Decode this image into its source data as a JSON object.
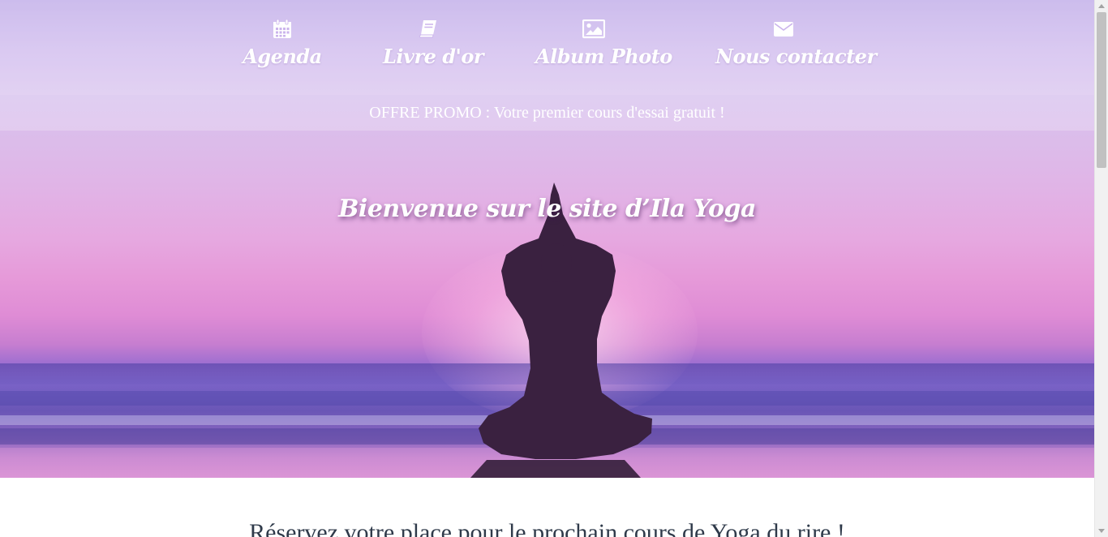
{
  "nav": {
    "items": [
      {
        "label": "Agenda",
        "icon": "calendar-icon"
      },
      {
        "label": "Livre d'or",
        "icon": "book-icon"
      },
      {
        "label": "Album Photo",
        "icon": "image-icon"
      },
      {
        "label": "Nous contacter",
        "icon": "envelope-icon"
      }
    ]
  },
  "promo": {
    "text": "OFFRE PROMO : Votre premier cours d'essai gratuit !"
  },
  "hero": {
    "title": "Bienvenue sur le site d’Ila Yoga"
  },
  "section": {
    "heading": "Réservez votre place pour le prochain cours de Yoga du rire !"
  },
  "colors": {
    "nav_text": "#ffffff",
    "heading_text": "#2f3a4a",
    "sky_top": "#b9a3e6",
    "sea": "#6a56b6"
  }
}
